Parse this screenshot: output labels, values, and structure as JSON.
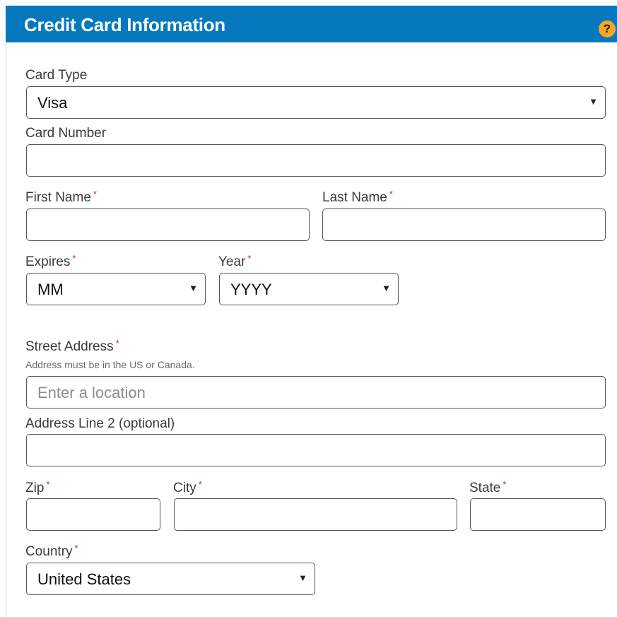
{
  "header": {
    "title": "Credit Card Information",
    "help_icon": "?"
  },
  "required_marker": "*",
  "card_type": {
    "label": "Card Type",
    "selected": "Visa"
  },
  "card_number": {
    "label": "Card Number",
    "value": ""
  },
  "first_name": {
    "label": "First Name",
    "value": ""
  },
  "last_name": {
    "label": "Last Name",
    "value": ""
  },
  "expires": {
    "label": "Expires",
    "selected": "MM"
  },
  "year": {
    "label": "Year",
    "selected": "YYYY"
  },
  "street_address": {
    "label": "Street Address",
    "hint": "Address must be in the US or Canada.",
    "placeholder": "Enter a location"
  },
  "address_line2": {
    "label": "Address Line 2 (optional)",
    "value": ""
  },
  "zip": {
    "label": "Zip",
    "value": ""
  },
  "city": {
    "label": "City",
    "value": ""
  },
  "state": {
    "label": "State",
    "value": ""
  },
  "country": {
    "label": "Country",
    "selected": "United States"
  },
  "colors": {
    "header_bg": "#0678be",
    "required": "#d9241c",
    "help_icon": "#f5a623"
  },
  "icons": {
    "dropdown": "caret-down-icon",
    "help": "help-icon"
  }
}
